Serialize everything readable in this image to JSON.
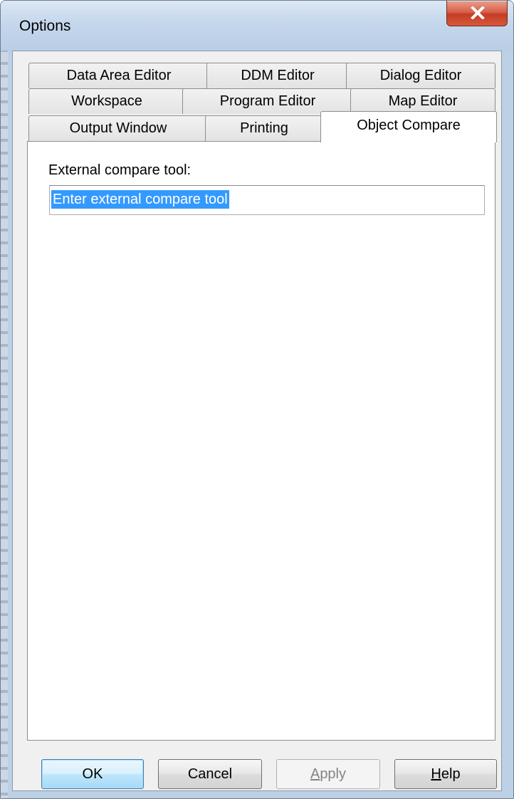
{
  "window": {
    "title": "Options",
    "close_glyph": "✕"
  },
  "tabs": {
    "row1": [
      {
        "label": "Data Area Editor"
      },
      {
        "label": "DDM Editor"
      },
      {
        "label": "Dialog Editor"
      }
    ],
    "row2": [
      {
        "label": "Workspace"
      },
      {
        "label": "Program Editor"
      },
      {
        "label": "Map Editor"
      }
    ],
    "row3": [
      {
        "label": "Output Window"
      },
      {
        "label": "Printing"
      },
      {
        "label": "Object Compare",
        "active": true
      }
    ]
  },
  "object_compare": {
    "field_label": "External compare tool:",
    "field_value": "Enter external compare tool"
  },
  "buttons": {
    "ok": "OK",
    "cancel": "Cancel",
    "apply_accel": "A",
    "apply_rest": "pply",
    "help_accel": "H",
    "help_rest": "elp"
  },
  "colors": {
    "selection": "#3399ff",
    "close_button": "#c33d25",
    "titlebar": "#c5d7ec"
  }
}
